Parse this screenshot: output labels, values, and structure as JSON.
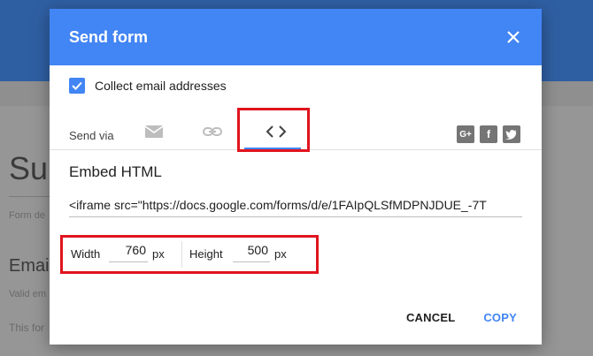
{
  "background": {
    "title_fragment": "Sub",
    "subtitle_fragment": "Form de",
    "email_heading": "Email",
    "valid_fragment": "Valid em",
    "this_fragment": "This for"
  },
  "dialog": {
    "title": "Send form",
    "collect_label": "Collect email addresses",
    "collect_checked": true,
    "send_via_label": "Send via",
    "tabs": [
      {
        "name": "email",
        "icon": "envelope-icon"
      },
      {
        "name": "link",
        "icon": "link-icon"
      },
      {
        "name": "embed",
        "icon": "code-icon",
        "active": true
      }
    ],
    "share_icons": [
      "google-plus-icon",
      "facebook-icon",
      "twitter-icon"
    ],
    "embed_title": "Embed HTML",
    "iframe_code": "<iframe src=\"https://docs.google.com/forms/d/e/1FAIpQLSfMDPNJDUE_-7T",
    "width_label": "Width",
    "width_value": "760",
    "width_unit": "px",
    "height_label": "Height",
    "height_value": "500",
    "height_unit": "px",
    "cancel_label": "CANCEL",
    "copy_label": "COPY"
  },
  "colors": {
    "accent": "#4285f4",
    "highlight": "#e0141e"
  }
}
